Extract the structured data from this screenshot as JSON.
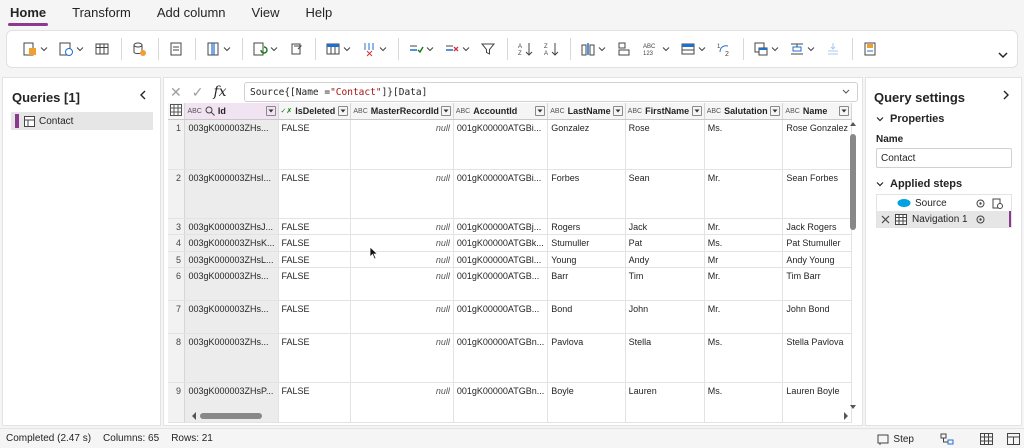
{
  "menu": {
    "tabs": [
      "Home",
      "Transform",
      "Add column",
      "View",
      "Help"
    ],
    "active": "Home"
  },
  "ribbon": {
    "icons": [
      "get-data-icon",
      "enter-data-icon",
      "options-icon",
      "manage-parameters-icon",
      "refresh-icon",
      "properties-icon",
      "advanced-editor-icon",
      "manage-columns-icon",
      "choose-columns-icon",
      "remove-columns-icon",
      "keep-rows-icon",
      "remove-rows-icon",
      "filter-icon",
      "sort-ascending-icon",
      "sort-descending-icon",
      "split-column-icon",
      "group-by-icon",
      "data-type-icon",
      "use-first-row-headers-icon",
      "replace-values-icon",
      "combine-icon",
      "map-to-entity-icon",
      "append-queries-icon",
      "insights-icon"
    ]
  },
  "queries": {
    "title": "Queries [1]",
    "items": [
      {
        "label": "Contact"
      }
    ]
  },
  "formula": {
    "prefix": "Source{[Name = ",
    "string": "\"Contact\"",
    "suffix": "]}[Data]",
    "fx": "fx"
  },
  "grid": {
    "columns": [
      {
        "type": "ABC",
        "label": "Id"
      },
      {
        "type": "✓✗",
        "label": "IsDeleted"
      },
      {
        "type": "ABC",
        "label": "MasterRecordId"
      },
      {
        "type": "ABC",
        "label": "AccountId"
      },
      {
        "type": "ABC",
        "label": "LastName"
      },
      {
        "type": "ABC",
        "label": "FirstName"
      },
      {
        "type": "ABC",
        "label": "Salutation"
      },
      {
        "type": "ABC",
        "label": "Name"
      }
    ],
    "rows": [
      {
        "n": "1",
        "id": "003gK000003ZHs...",
        "deleted": "FALSE",
        "master": "null",
        "account": "001gK00000ATGBi...",
        "last": "Gonzalez",
        "first": "Rose",
        "sal": "Ms.",
        "name": "Rose Gonzalez"
      },
      {
        "n": "2",
        "id": "003gK000003ZHsI...",
        "deleted": "FALSE",
        "master": "null",
        "account": "001gK00000ATGBi...",
        "last": "Forbes",
        "first": "Sean",
        "sal": "Mr.",
        "name": "Sean Forbes"
      },
      {
        "n": "3",
        "id": "003gK000003ZHsJ...",
        "deleted": "FALSE",
        "master": "null",
        "account": "001gK00000ATGBj...",
        "last": "Rogers",
        "first": "Jack",
        "sal": "Mr.",
        "name": "Jack Rogers"
      },
      {
        "n": "4",
        "id": "003gK000003ZHsK...",
        "deleted": "FALSE",
        "master": "null",
        "account": "001gK00000ATGBk...",
        "last": "Stumuller",
        "first": "Pat",
        "sal": "Ms.",
        "name": "Pat Stumuller"
      },
      {
        "n": "5",
        "id": "003gK000003ZHsL...",
        "deleted": "FALSE",
        "master": "null",
        "account": "001gK00000ATGBl...",
        "last": "Young",
        "first": "Andy",
        "sal": "Mr",
        "name": "Andy Young"
      },
      {
        "n": "6",
        "id": "003gK000003ZHs...",
        "deleted": "FALSE",
        "master": "null",
        "account": "001gK00000ATGB...",
        "last": "Barr",
        "first": "Tim",
        "sal": "Mr.",
        "name": "Tim Barr"
      },
      {
        "n": "7",
        "id": "003gK000003ZHs...",
        "deleted": "FALSE",
        "master": "null",
        "account": "001gK00000ATGB...",
        "last": "Bond",
        "first": "John",
        "sal": "Mr.",
        "name": "John Bond"
      },
      {
        "n": "8",
        "id": "003gK000003ZHs...",
        "deleted": "FALSE",
        "master": "null",
        "account": "001gK00000ATGBn...",
        "last": "Pavlova",
        "first": "Stella",
        "sal": "Ms.",
        "name": "Stella Pavlova"
      },
      {
        "n": "9",
        "id": "003gK000003ZHsP...",
        "deleted": "FALSE",
        "master": "null",
        "account": "001gK00000ATGBn...",
        "last": "Boyle",
        "first": "Lauren",
        "sal": "Ms.",
        "name": "Lauren Boyle"
      }
    ]
  },
  "settings": {
    "title": "Query settings",
    "properties_label": "Properties",
    "name_label": "Name",
    "name_value": "Contact",
    "applied_steps_label": "Applied steps",
    "steps": [
      {
        "label": "Source",
        "icon": "salesforce-icon"
      },
      {
        "label": "Navigation 1",
        "icon": "table-icon"
      }
    ]
  },
  "status": {
    "completed": "Completed (2.47 s)",
    "columns": "Columns: 65",
    "rows": "Rows: 21",
    "step_label": "Step"
  },
  "colors": {
    "accent": "#8b3a8f",
    "icon_blue": "#1f6fd1",
    "green": "#107c10",
    "orange": "#c75b12",
    "salesforce": "#00a1e0"
  }
}
